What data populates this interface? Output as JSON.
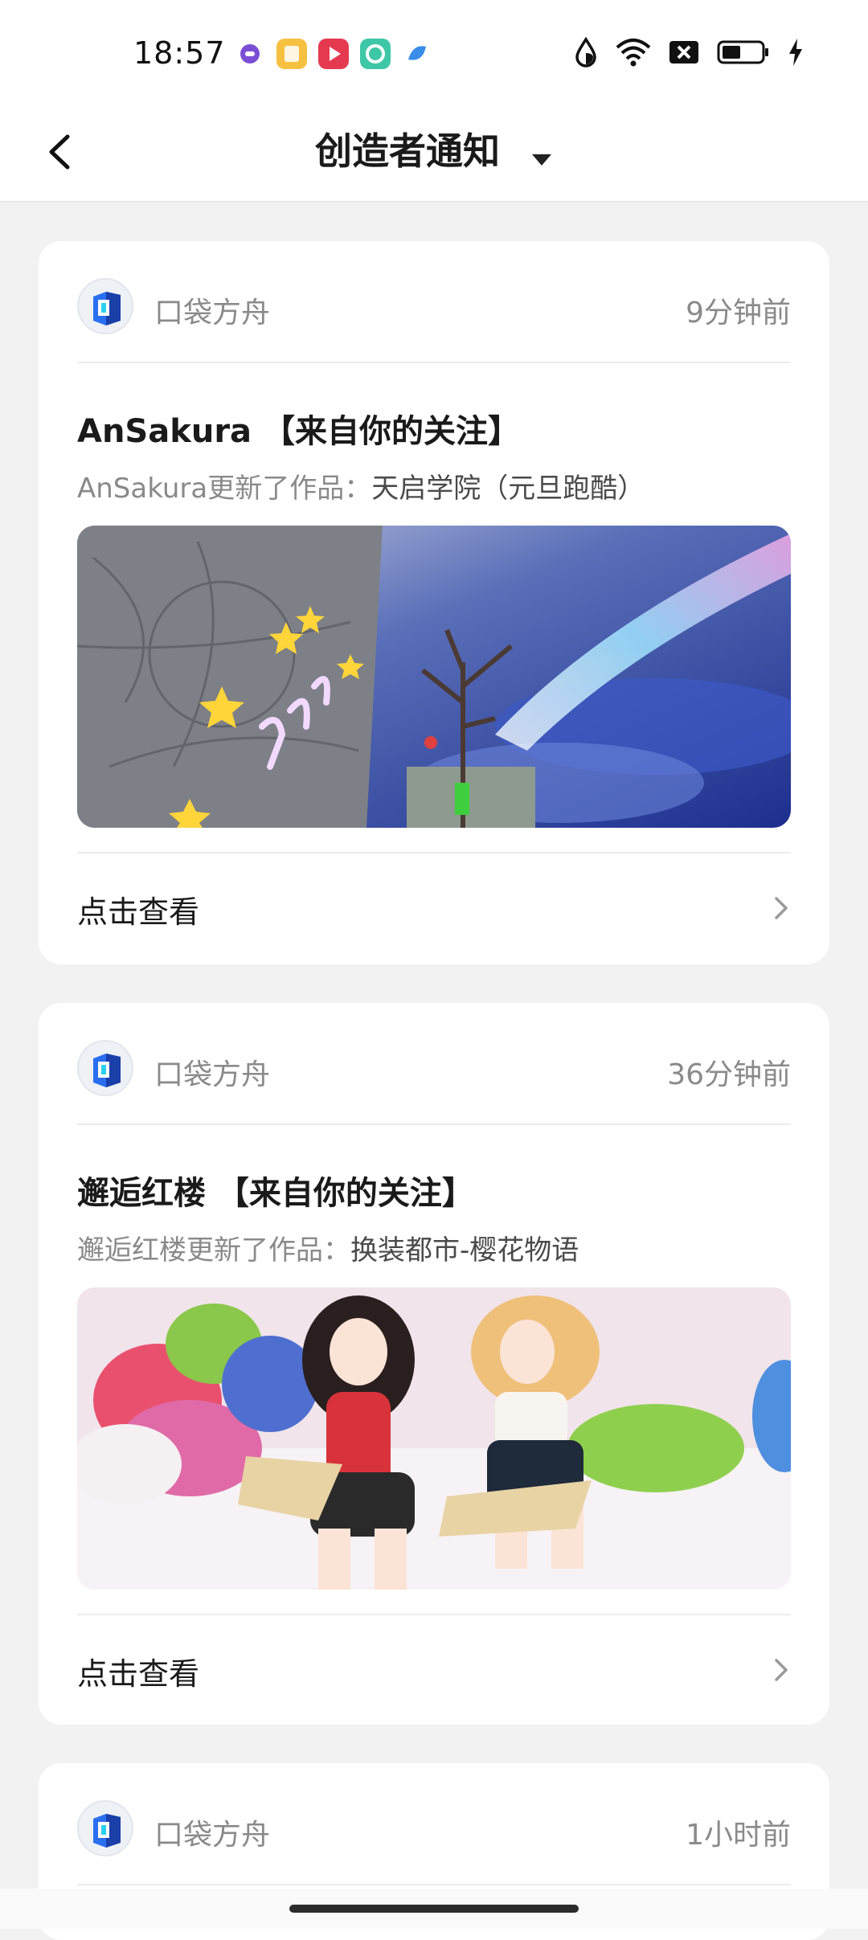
{
  "status_bar": {
    "time": "18:57",
    "app_icon_colors": [
      "#7a4fd6",
      "#f6c141",
      "#e53950",
      "#3ec7a7",
      "#3a8de8"
    ]
  },
  "header": {
    "title": "创造者通知",
    "back_icon": "chevron-left-icon",
    "dropdown_icon": "caret-down-icon"
  },
  "notifications": [
    {
      "source": "口袋方舟",
      "time_ago": "9分钟前",
      "title": "AnSakura 【来自你的关注】",
      "desc_prefix": "AnSakura更新了作品：",
      "work_name": "天启学院（元旦跑酷）",
      "thumbnail": "game-scene-neon-stars-tree-rainbow-sky",
      "action_label": "点击查看"
    },
    {
      "source": "口袋方舟",
      "time_ago": "36分钟前",
      "title": "邂逅红楼 【来自你的关注】",
      "desc_prefix": "邂逅红楼更新了作品：",
      "work_name": "换装都市-樱花物语",
      "thumbnail": "two-anime-girls-reading-on-bed",
      "action_label": "点击查看"
    },
    {
      "source": "口袋方舟",
      "time_ago": "1小时前"
    }
  ],
  "colors": {
    "background": "#f2f2f2",
    "card": "#ffffff",
    "muted_text": "#8a8a8a",
    "primary_text": "#1a1a1a"
  }
}
